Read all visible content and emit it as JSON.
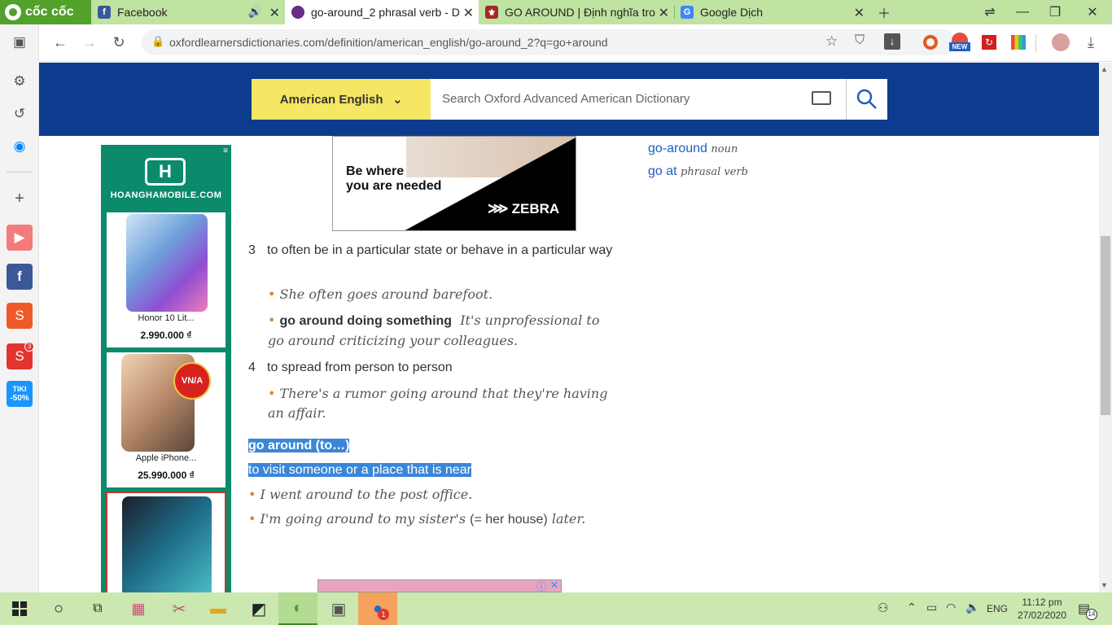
{
  "browser": {
    "brand": "cốc cốc",
    "tabs": [
      {
        "title": "Facebook",
        "icon": "facebook-icon"
      },
      {
        "title": "go-around_2 phrasal verb - D",
        "icon": "oxford-icon"
      },
      {
        "title": "GO AROUND | Định nghĩa tro",
        "icon": "cambridge-icon"
      },
      {
        "title": "Google Dịch",
        "icon": "google-translate-icon"
      }
    ],
    "url": "oxfordlearnersdictionaries.com/definition/american_english/go-around_2?q=go+around",
    "new_badge": "NEW"
  },
  "header": {
    "language": "American English",
    "search_placeholder": "Search Oxford Advanced American Dictionary"
  },
  "ad_top": {
    "line1": "Be where",
    "line2": "you are needed",
    "brand": "ZEBRA"
  },
  "side_ad": {
    "brand": "HOANGHAMOBILE.COM",
    "products": [
      {
        "name": "Honor 10 Lit...",
        "price": "2.990.000 ₫"
      },
      {
        "name": "Apple iPhone...",
        "price": "25.990.000 ₫"
      }
    ],
    "badge": "VN/A"
  },
  "entry": {
    "senses": [
      {
        "num": "3",
        "def": "to often be in a particular state or behave in a particular way",
        "examples": [
          {
            "pattern": "",
            "text": "She often goes around barefoot."
          },
          {
            "pattern": "go around doing something",
            "text": "It's unprofessional to go around criticizing your colleagues."
          }
        ]
      },
      {
        "num": "4",
        "def": "to spread from person to person",
        "examples": [
          {
            "pattern": "",
            "text": "There's a rumor going around that they're having an affair."
          }
        ]
      }
    ],
    "phrase": {
      "headword": "go around (to…)",
      "def": "to visit someone or a place that is near",
      "ex1": "I went around to the post office.",
      "ex2_a": "I'm going around to my sister's",
      "ex2_b": "(= her house)",
      "ex2_c": "later."
    }
  },
  "related": [
    {
      "word": "go-around",
      "pos": "noun"
    },
    {
      "word": "go at",
      "pos": "phrasal verb"
    }
  ],
  "taskbar": {
    "lang": "ENG",
    "time": "11:12 pm",
    "date": "27/02/2020",
    "notifications": "14",
    "zalo_badge": "1",
    "shopee_badge": "3"
  },
  "sidebar_labels": {
    "tiki": "TIKI",
    "tiki_sale": "-50%"
  },
  "colors": {
    "oxford_blue": "#0d3c8f",
    "lang_yellow": "#f5e664",
    "highlight": "#3b86d8",
    "coccoc_green": "#52a12b"
  }
}
